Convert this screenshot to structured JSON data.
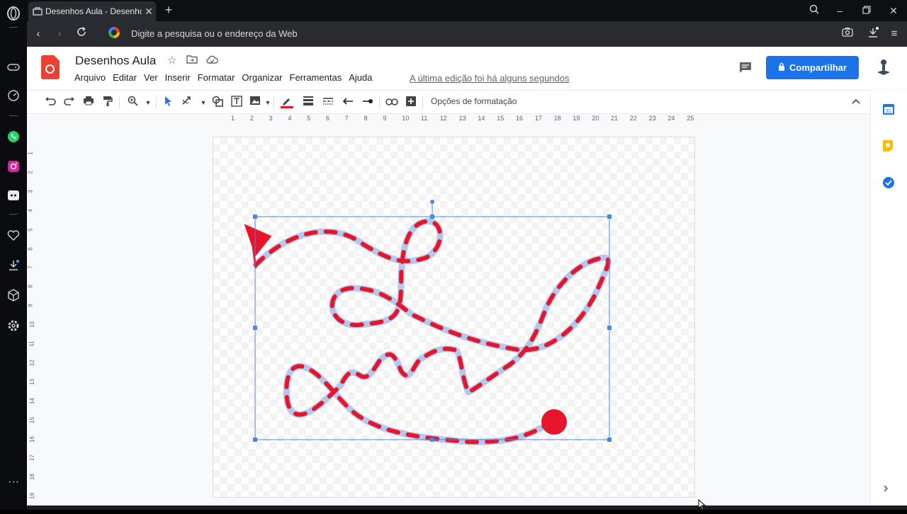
{
  "browser": {
    "tab_title": "Desenhos Aula - Desenhos",
    "new_tab_label": "+",
    "address_placeholder": "Digite a pesquisa ou o endereço da Web"
  },
  "opera_sidebar": {
    "items": [
      "opera-logo-icon",
      "gamepad-icon",
      "speed-dial-icon",
      "whatsapp-icon",
      "instagram-icon",
      "discord-icon",
      "heart-icon",
      "download-icon",
      "cube-icon",
      "settings-icon",
      "more-icon"
    ]
  },
  "docs": {
    "title": "Desenhos Aula",
    "menu": [
      "Arquivo",
      "Editar",
      "Ver",
      "Inserir",
      "Formatar",
      "Organizar",
      "Ferramentas",
      "Ajuda"
    ],
    "last_edit": "A última edição foi há alguns segundos",
    "share_label": "Compartilhar",
    "format_options": "Opções de formatação"
  },
  "ruler": {
    "horizontal": [
      "1",
      "2",
      "3",
      "4",
      "5",
      "6",
      "7",
      "8",
      "9",
      "10",
      "11",
      "12",
      "13",
      "14",
      "15",
      "16",
      "17",
      "18",
      "19",
      "20",
      "21",
      "22",
      "23",
      "24",
      "25"
    ],
    "vertical": [
      "1",
      "2",
      "3",
      "4",
      "5",
      "6",
      "7",
      "8",
      "9",
      "10",
      "11",
      "12",
      "13",
      "14",
      "15",
      "16",
      "17",
      "18",
      "19"
    ]
  },
  "colors": {
    "accent": "#1a73e8",
    "line_red": "#e8152a",
    "line_blue": "#b3c8ee",
    "selection": "#4a86e8"
  }
}
